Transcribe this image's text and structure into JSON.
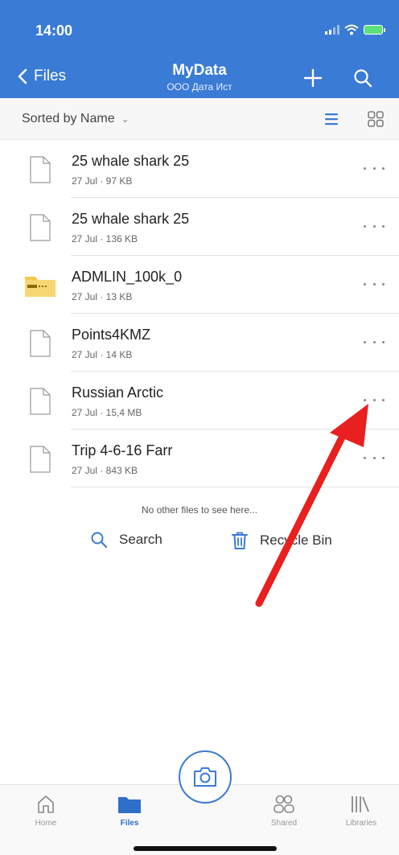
{
  "status": {
    "time": "14:00"
  },
  "nav": {
    "back_label": "Files",
    "title": "MyData",
    "subtitle": "ООО Дата Ист"
  },
  "sort": {
    "label": "Sorted by Name",
    "chevron": "⌄"
  },
  "files": [
    {
      "name": "25 whale shark 25",
      "meta": "27 Jul · 97 KB",
      "icon": "document-icon"
    },
    {
      "name": "25 whale shark 25",
      "meta": "27 Jul · 136 KB",
      "icon": "document-icon"
    },
    {
      "name": "ADMLIN_100k_0",
      "meta": "27 Jul · 13 KB",
      "icon": "zip-folder-icon"
    },
    {
      "name": "Points4KMZ",
      "meta": "27 Jul · 14 KB",
      "icon": "document-icon"
    },
    {
      "name": "Russian Arctic",
      "meta": "27 Jul · 15,4 MB",
      "icon": "document-icon"
    },
    {
      "name": "Trip 4-6-16 Farr",
      "meta": "27 Jul · 843 KB",
      "icon": "document-icon"
    }
  ],
  "empty_note": "No other files to see here...",
  "actions": {
    "search_label": "Search",
    "recycle_label": "Recycle Bin"
  },
  "tabs": [
    {
      "label": "Home",
      "icon": "home-icon"
    },
    {
      "label": "Files",
      "icon": "folder-icon"
    },
    {
      "label": "Shared",
      "icon": "shared-icon"
    },
    {
      "label": "Libraries",
      "icon": "libraries-icon"
    }
  ],
  "colors": {
    "accent": "#3a7bd5",
    "annotation_arrow": "#e8201f"
  }
}
